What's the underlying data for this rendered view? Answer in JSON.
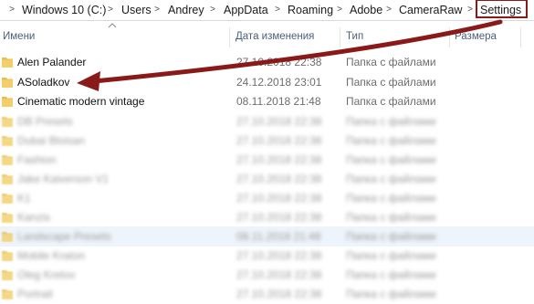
{
  "breadcrumb": {
    "items": [
      "Windows 10 (C:)",
      "Users",
      "Andrey",
      "AppData",
      "Roaming",
      "Adobe",
      "CameraRaw",
      "Settings"
    ]
  },
  "columns": {
    "name": "Имени",
    "date": "Дата изменения",
    "type": "Тип",
    "size": "Размера"
  },
  "rows": [
    {
      "name": "Alen Palander",
      "date": "27.10.2018 22:38",
      "type": "Папка с файлами"
    },
    {
      "name": "ASoladkov",
      "date": "24.12.2018 23:01",
      "type": "Папка с файлами"
    },
    {
      "name": "Cinematic modern vintage",
      "date": "08.11.2018 21:48",
      "type": "Папка с файлами"
    }
  ],
  "blurred_rows": [
    {
      "name": "DB Presets",
      "date": "27.10.2018 22:38",
      "type": "Папка с файлами"
    },
    {
      "name": "Dubai Bloisan",
      "date": "27.10.2018 22:38",
      "type": "Папка с файлами"
    },
    {
      "name": "Fashion",
      "date": "27.10.2018 22:38",
      "type": "Папка с файлами"
    },
    {
      "name": "Jake Kaiverson V1",
      "date": "27.10.2018 22:38",
      "type": "Папка с файлами"
    },
    {
      "name": "K1",
      "date": "27.10.2018 22:38",
      "type": "Папка с файлами"
    },
    {
      "name": "Kanzis",
      "date": "27.10.2018 22:38",
      "type": "Папка с файлами"
    },
    {
      "name": "Landscape Presets",
      "date": "08.11.2018 21:48",
      "type": "Папка с файлами"
    },
    {
      "name": "Mobile Kraton",
      "date": "27.10.2018 22:38",
      "type": "Папка с файлами"
    },
    {
      "name": "Oleg Kretov",
      "date": "27.10.2018 22:38",
      "type": "Папка с файлами"
    },
    {
      "name": "Portrait",
      "date": "27.10.2018 22:38",
      "type": "Папка с файлами"
    }
  ],
  "colors": {
    "folder": "#e8bf4f",
    "annotation": "#8a1a1a",
    "header_text": "#4c607a"
  },
  "icons": {
    "folder": "folder-icon",
    "separator": "chevron-right-icon",
    "sort": "sort-caret-icon",
    "annotation": "annotation-arrow"
  }
}
